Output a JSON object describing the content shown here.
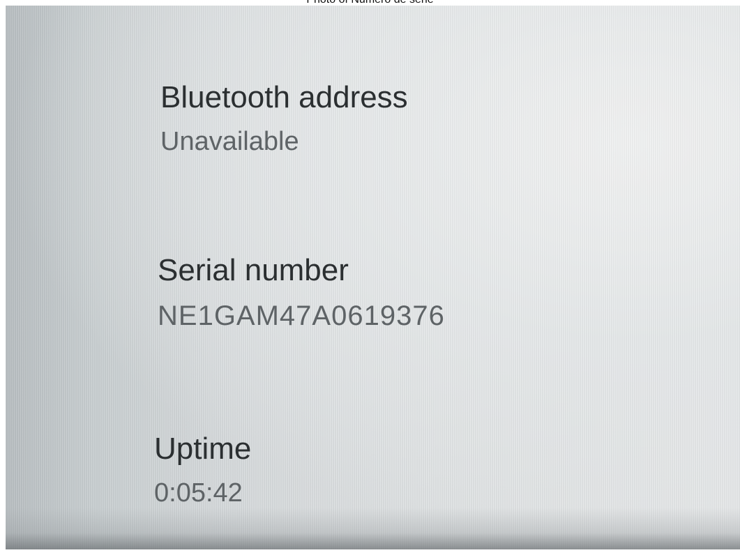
{
  "caption": "Photo of Número de série",
  "settings": {
    "items": [
      {
        "title": "Bluetooth address",
        "value": "Unavailable"
      },
      {
        "title": "Serial number",
        "value": "NE1GAM47A0619376"
      },
      {
        "title": "Uptime",
        "value": "0:05:42"
      }
    ]
  },
  "colors": {
    "title_text": "#2b2f31",
    "value_text": "#5e6366",
    "screen_background": "#dfe2e3"
  }
}
